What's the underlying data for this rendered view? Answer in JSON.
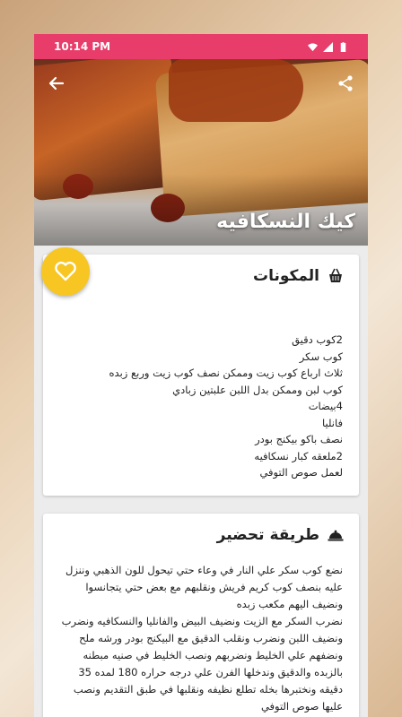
{
  "status_bar": {
    "time": "10:14 PM"
  },
  "recipe": {
    "title": "كيك النسكافيه"
  },
  "ingredients": {
    "title": "المكونات",
    "text": "2كوب دقيق\nكوب سكر\nثلاث ارباع كوب زيت وممكن نصف كوب زيت وربع زبده\nكوب لبن وممكن بدل اللبن علبتين زبادي\n4بيضات\nفانليا\nنصف باكو بيكنج بودر\n2ملعقه كبار نسكافيه\nلعمل صوص التوفي"
  },
  "preparation": {
    "title": "طريقة تحضير",
    "text": "نضع كوب سكر علي النار في وعاء حتي تيحول للون الذهبي وننزل عليه بنصف كوب كريم فريش ونقلبهم مع بعض حتي يتجانسوا ونضيف اليهم مكعب زبده\nنضرب السكر مع الزيت ونضيف البيض والفانليا والنسكافيه ونضرب ونضيف اللبن ونضرب ونقلب الدقيق مع البيكنج بودر ورشه ملح ونضفهم علي الخليط ونضربهم ونصب الخليط في صنيه مبطنه بالزبده والدقيق وندخلها الفرن علي درجه حراره 180 لمده 35 دقيقه ونختبرها بخله تطلع نظيفه ونقلبها في طبق التقديم ونصب عليها صوص التوفي"
  },
  "colors": {
    "status_bar": "#e83c6a",
    "fab": "#f7c623"
  },
  "icons": {
    "back": "arrow-left-icon",
    "share": "share-icon",
    "favorite": "heart-icon",
    "ingredients": "basket-icon",
    "preparation": "cloche-icon"
  }
}
